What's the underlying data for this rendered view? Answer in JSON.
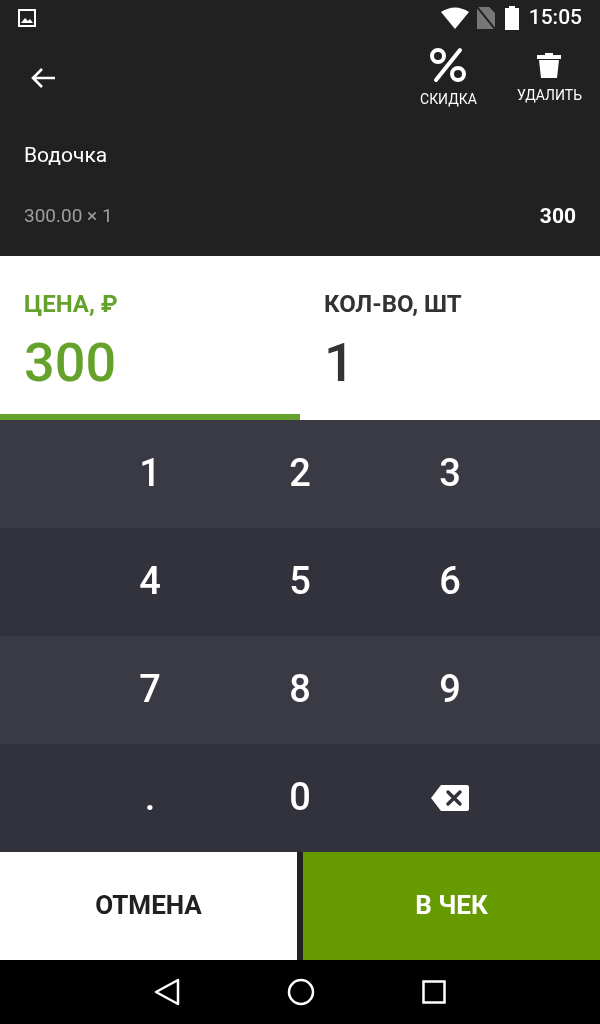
{
  "status_bar": {
    "time": "15:05"
  },
  "toolbar": {
    "actions": [
      {
        "kind": "discount",
        "label": "СКИДКА"
      },
      {
        "kind": "delete",
        "label": "УДАЛИТЬ"
      }
    ]
  },
  "item": {
    "name": "Водочка",
    "calculation": "300.00 × 1",
    "total": "300"
  },
  "fields": [
    {
      "label": "ЦЕНА, ₽",
      "value": "300",
      "selected": true
    },
    {
      "label": "КОЛ-ВО, ШТ",
      "value": "1",
      "selected": false
    }
  ],
  "keypad": [
    [
      {
        "kind": "digit",
        "label": "1"
      },
      {
        "kind": "digit",
        "label": "2"
      },
      {
        "kind": "digit",
        "label": "3"
      }
    ],
    [
      {
        "kind": "digit",
        "label": "4"
      },
      {
        "kind": "digit",
        "label": "5"
      },
      {
        "kind": "digit",
        "label": "6"
      }
    ],
    [
      {
        "kind": "digit",
        "label": "7"
      },
      {
        "kind": "digit",
        "label": "8"
      },
      {
        "kind": "digit",
        "label": "9"
      }
    ],
    [
      {
        "kind": "digit",
        "label": "."
      },
      {
        "kind": "digit",
        "label": "0"
      },
      {
        "kind": "backspace"
      }
    ]
  ],
  "buttons": [
    {
      "kind": "cancel",
      "label": "ОТМЕНА"
    },
    {
      "kind": "confirm",
      "label": "В ЧЕК"
    }
  ]
}
